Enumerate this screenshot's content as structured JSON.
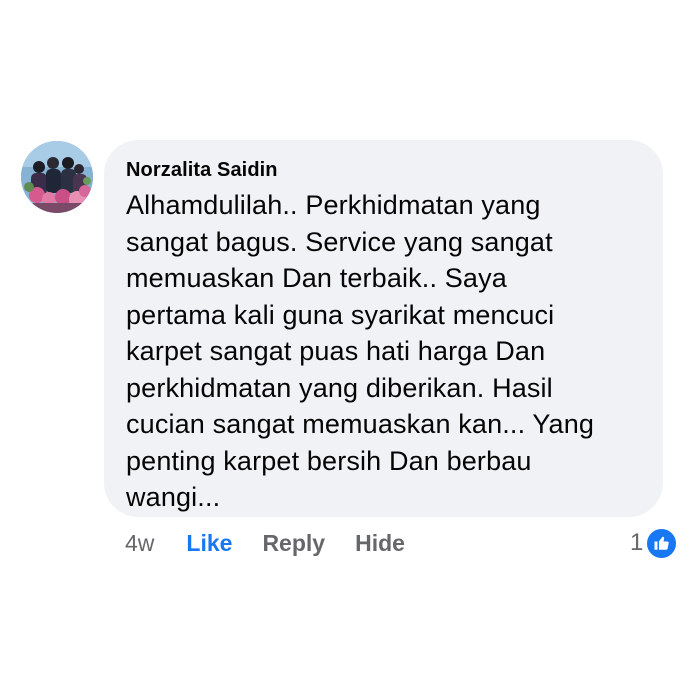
{
  "comment": {
    "author": "Norzalita Saidin",
    "lines": [
      "Alhamdulilah.. Perkhidmatan yang",
      "sangat bagus. Service yang sangat",
      "memuaskan Dan terbaik.. Saya",
      "pertama kali guna syarikat mencuci",
      "karpet sangat puas hati harga Dan",
      "perkhidmatan yang diberikan. Hasil",
      "cucian sangat memuaskan kan... Yang",
      "penting karpet bersih Dan berbau",
      "wangi..."
    ]
  },
  "actions": {
    "time": "4w",
    "like": "Like",
    "reply": "Reply",
    "hide": "Hide"
  },
  "reactions": {
    "count": "1",
    "icon": "thumbs-up-icon",
    "color": "#1877f2"
  }
}
